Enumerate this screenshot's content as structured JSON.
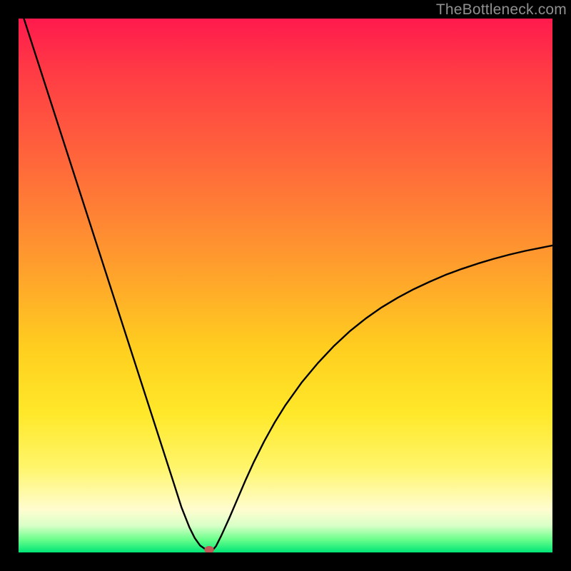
{
  "watermark": "TheBottleneck.com",
  "chart_data": {
    "type": "line",
    "title": "",
    "xlabel": "",
    "ylabel": "",
    "xlim": [
      0,
      100
    ],
    "ylim": [
      0,
      100
    ],
    "grid": false,
    "legend": false,
    "series": [
      {
        "name": "curve",
        "x": [
          1,
          3,
          5,
          7,
          9,
          11,
          13,
          15,
          17,
          19,
          21,
          23,
          25,
          27,
          29,
          30.5,
          32,
          33,
          34,
          35,
          35.5,
          36,
          36.5,
          37,
          38,
          39.5,
          41,
          42.5,
          44,
          46,
          48,
          50,
          53,
          56,
          59,
          62,
          65,
          68,
          71,
          74,
          77,
          80,
          83,
          86,
          89,
          92,
          95,
          98,
          100
        ],
        "y": [
          100,
          93.8,
          87.6,
          81.4,
          75.2,
          69,
          62.8,
          56.6,
          50.4,
          44.2,
          38,
          31.8,
          25.6,
          19.4,
          13.2,
          8.5,
          4.7,
          2.7,
          1.3,
          0.6,
          0.5,
          0.5,
          0.6,
          1.2,
          3.2,
          6.5,
          10,
          13.5,
          16.8,
          20.8,
          24.4,
          27.6,
          31.8,
          35.4,
          38.6,
          41.4,
          43.8,
          45.9,
          47.7,
          49.3,
          50.7,
          52,
          53.1,
          54.1,
          55,
          55.8,
          56.5,
          57.1,
          57.5
        ]
      }
    ],
    "marker": {
      "x": 35.7,
      "y": 0.5,
      "rx": 0.9,
      "ry": 0.7
    }
  }
}
